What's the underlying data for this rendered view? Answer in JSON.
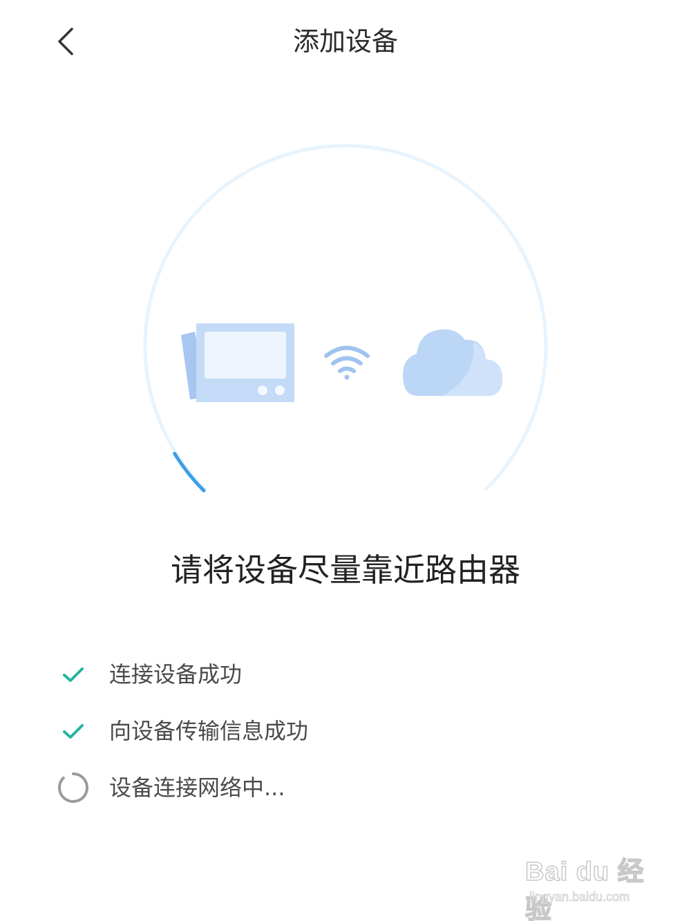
{
  "header": {
    "back_icon": "chevron-left-icon",
    "title": "添加设备"
  },
  "illustration": {
    "progress": 0.05,
    "ring_color": "#e8f4fd",
    "progress_color": "#3a9ee8",
    "device_icon": "router-device-icon",
    "wifi_icon": "wifi-icon",
    "cloud_icon": "cloud-icon"
  },
  "headline": "请将设备尽量靠近路由器",
  "steps": [
    {
      "label": "连接设备成功",
      "status": "done",
      "icon": "check-icon"
    },
    {
      "label": "向设备传输信息成功",
      "status": "done",
      "icon": "check-icon"
    },
    {
      "label": "设备连接网络中...",
      "status": "loading",
      "icon": "spinner-icon"
    }
  ],
  "colors": {
    "check": "#22b5a0",
    "spinner": "#9a9a9a"
  },
  "watermark": {
    "brand": "Bai du 经验",
    "url": "jingyan.baidu.com"
  }
}
